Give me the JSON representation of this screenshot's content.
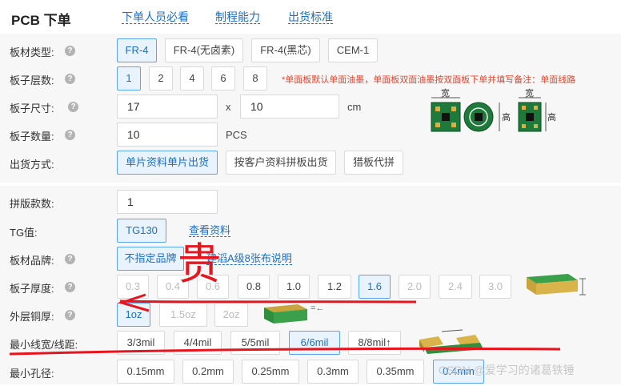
{
  "header": {
    "title": "PCB 下单",
    "links": [
      "下单人员必看",
      "制程能力",
      "出货标准"
    ]
  },
  "rows": {
    "material": {
      "label": "板材类型:",
      "options": [
        "FR-4",
        "FR-4(无卤素)",
        "FR-4(黑芯)",
        "CEM-1"
      ],
      "selected": "FR-4"
    },
    "layers": {
      "label": "板子层数:",
      "options": [
        "1",
        "2",
        "4",
        "6",
        "8"
      ],
      "selected": "1",
      "note": "*单面板默认单面油墨，单面板双面油墨按双面板下单并填写备注：单面线路"
    },
    "size": {
      "label": "板子尺寸:",
      "width": "17",
      "sep": "x",
      "height": "10",
      "unit": "cm"
    },
    "qty": {
      "label": "板子数量:",
      "value": "10",
      "unit": "PCS"
    },
    "ship": {
      "label": "出货方式:",
      "options": [
        "单片资料单片出货",
        "按客户资料拼板出货",
        "猎板代拼"
      ],
      "selected": "单片资料单片出货"
    },
    "panels": {
      "label": "拼版款数:",
      "value": "1"
    },
    "tg": {
      "label": "TG值:",
      "options": [
        "TG130"
      ],
      "selected": "TG130",
      "link": "查看资料"
    },
    "brand": {
      "label": "板材品牌:",
      "options": [
        "不指定品牌"
      ],
      "selected": "不指定品牌",
      "link": "建滔A级8张布说明"
    },
    "thickness": {
      "label": "板子厚度:",
      "options": [
        "0.3",
        "0.4",
        "0.6",
        "0.8",
        "1.0",
        "1.2",
        "1.6",
        "2.0",
        "2.4",
        "3.0"
      ],
      "disabled": [
        "0.3",
        "0.4",
        "0.6",
        "2.0",
        "2.4",
        "3.0"
      ],
      "selected": "1.6"
    },
    "copper": {
      "label": "外层铜厚:",
      "options": [
        "1oz",
        "1.5oz",
        "2oz"
      ],
      "disabled": [
        "1.5oz",
        "2oz"
      ],
      "selected": "1oz"
    },
    "trace": {
      "label": "最小线宽/线距:",
      "options": [
        "3/3mil",
        "4/4mil",
        "5/5mil",
        "6/6mil",
        "8/8mil↑"
      ],
      "selected": "6/6mil"
    },
    "hole": {
      "label": "最小孔径:",
      "options": [
        "0.15mm",
        "0.2mm",
        "0.25mm",
        "0.3mm",
        "0.35mm",
        "0.4mm"
      ],
      "selected": "0.4mm"
    }
  },
  "illustration": {
    "width_label": "宽",
    "height_label": "高"
  },
  "annotation": {
    "handwritten": "贵"
  },
  "watermark": "CSDN @爱学习的诸葛铁锤",
  "colors": {
    "accent": "#1a6fc9",
    "selected_bg": "#e8f3fd",
    "note": "#e2452b",
    "pen": "#e8141d"
  }
}
